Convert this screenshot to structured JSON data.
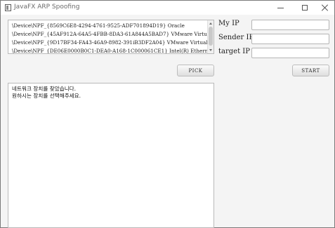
{
  "window": {
    "title": "JavaFX ARP Spoofing"
  },
  "devices": [
    "\\Device\\NPF_{8569C6E8-4294-4761-9525-ADF701894D19} Oracle",
    "\\Device\\NPF_{45AF912A-64A5-4FBB-8DA3-61A844A5BAD7} VMware Virtual Ethernet",
    "\\Device\\NPF_{9D17BF34-FA43-46A9-8982-391iB3DF2A04} VMware Virtual Ethernet",
    "\\Device\\NPF_{DE06E0000B0C1-DEA0-A168-1C000061CE1} Intel(R) Ethernet Conn"
  ],
  "fields": {
    "my_ip_label": "My IP",
    "sender_ip_label": "Sender IP",
    "target_ip_label": "target IP",
    "my_ip_value": "",
    "sender_ip_value": "",
    "target_ip_value": ""
  },
  "buttons": {
    "pick": "PICK",
    "start": "START"
  },
  "log": {
    "lines": [
      "네트워크 장치를 찾았습니다.",
      "원하시는 장치를 선택해주세요."
    ]
  }
}
